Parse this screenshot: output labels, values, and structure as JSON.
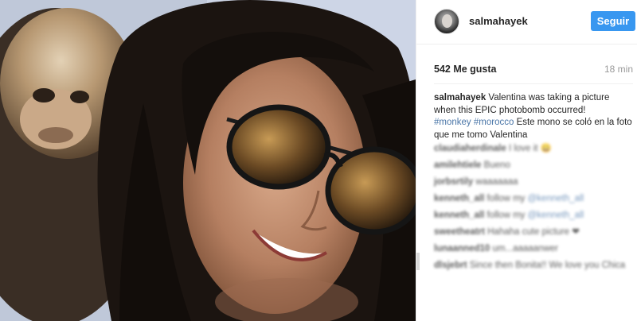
{
  "post": {
    "username": "salmahayek",
    "follow_label": "Seguir",
    "likes": "542 Me gusta",
    "time_ago": "18 min",
    "caption": {
      "user": "salmahayek",
      "text1": " Valentina was taking a picture when this EPIC photobomb occurred!",
      "tag1": "#monkey",
      "tag2": "#morocco",
      "text2": " Este mono se coló en la foto que me tomo Valentina"
    }
  },
  "comments": [
    {
      "user": "claudiaherdinale",
      "text": "I love it 😀",
      "mention": ""
    },
    {
      "user": "amilehtiele",
      "text": "Bueno",
      "mention": ""
    },
    {
      "user": "jorbsrtily",
      "text": "waaaaaaa",
      "mention": ""
    },
    {
      "user": "kenneth_all",
      "text": "follow my",
      "mention": "@kenneth_all"
    },
    {
      "user": "kenneth_all",
      "text": "follow my",
      "mention": "@kenneth_all"
    },
    {
      "user": "sweetheatrt",
      "text": "Hahaha cute picture ❤",
      "mention": ""
    },
    {
      "user": "lunaanned10",
      "text": "um...aaaaanwer",
      "mention": ""
    },
    {
      "user": "dlsjebrt",
      "text": "Since then Bonita!! We love you Chica",
      "mention": ""
    }
  ],
  "icons": {
    "avatar": "profile-avatar-icon"
  },
  "colors": {
    "follow_button": "#3897f0",
    "hashtag": "#4a76a8",
    "time_text": "#999999"
  }
}
